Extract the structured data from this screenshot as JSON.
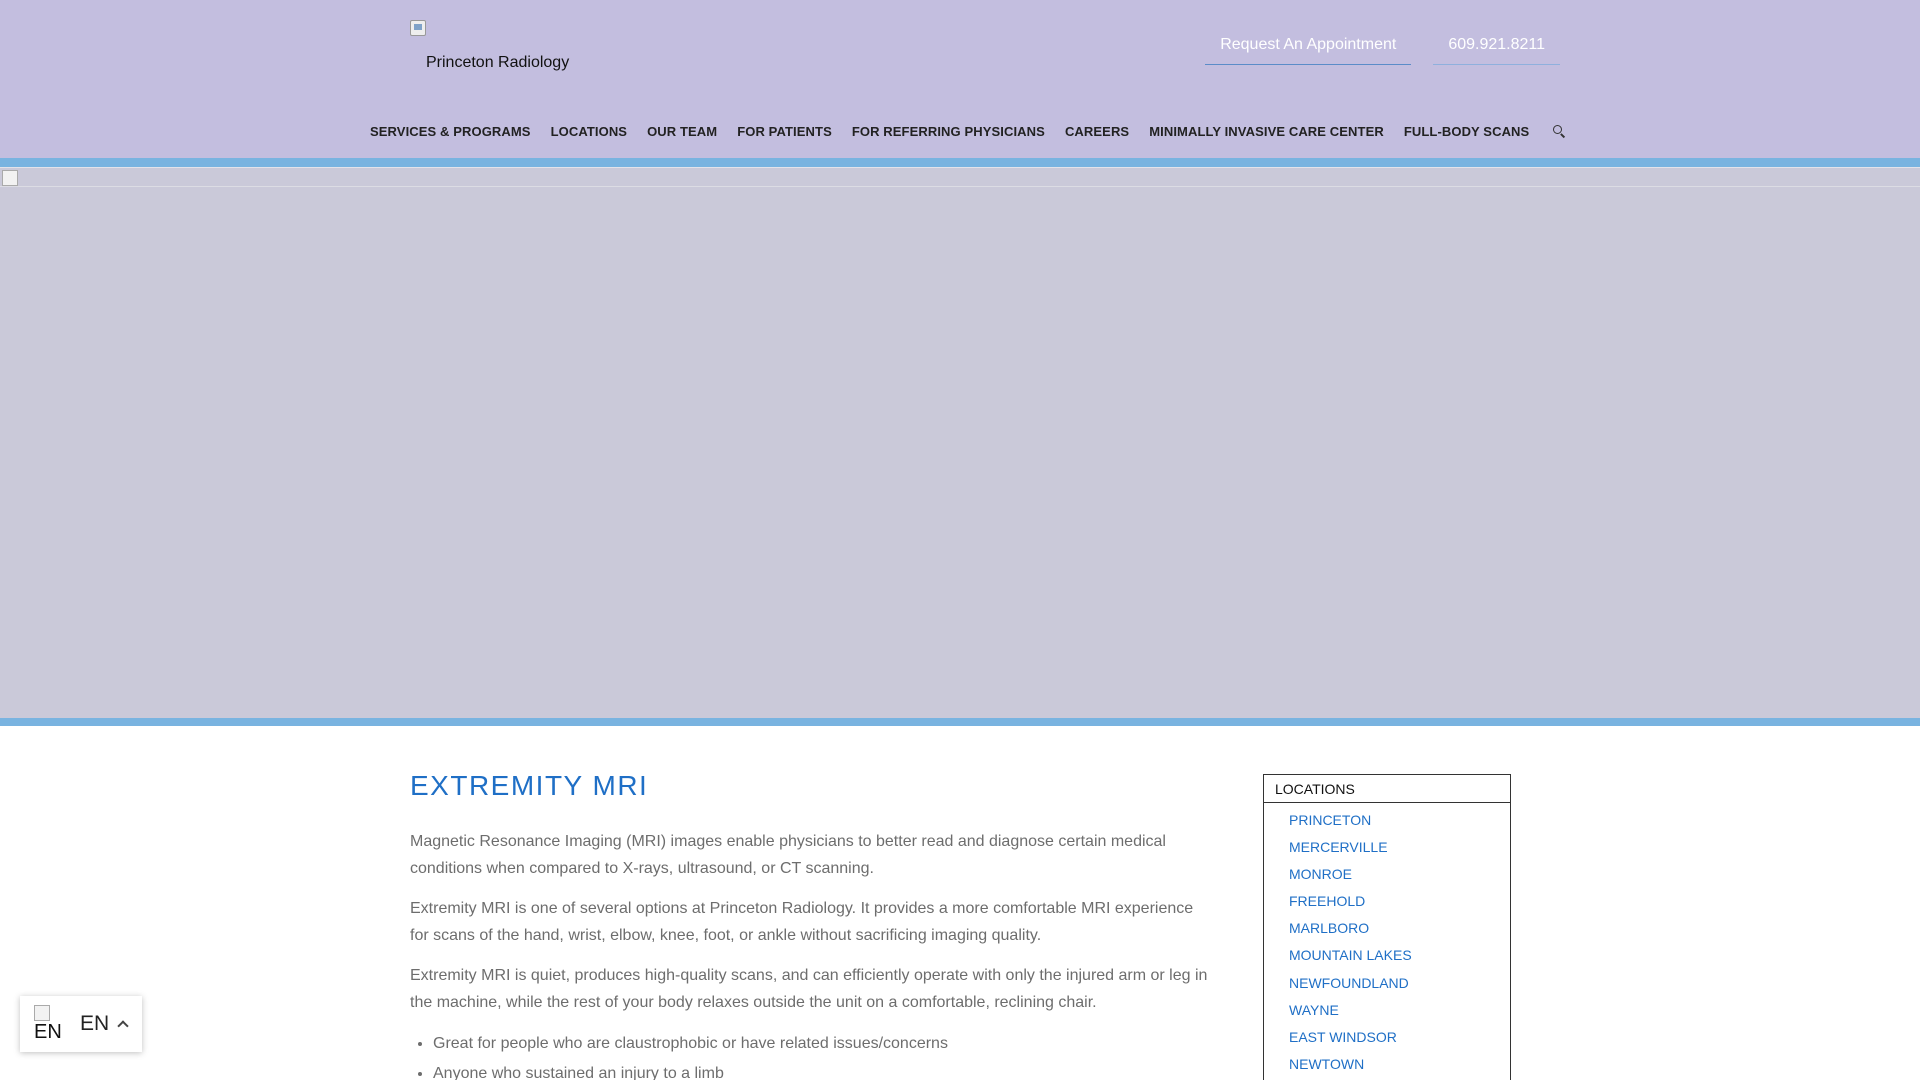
{
  "header": {
    "logo_alt": "Princeton Radiology",
    "appointment_label": "Request An Appointment",
    "phone_label": " 609.921.8211"
  },
  "nav": {
    "items": [
      {
        "label": "SERVICES & PROGRAMS"
      },
      {
        "label": "LOCATIONS"
      },
      {
        "label": "OUR TEAM"
      },
      {
        "label": "FOR PATIENTS"
      },
      {
        "label": "FOR REFERRING PHYSICIANS"
      },
      {
        "label": "CAREERS"
      },
      {
        "label": "MINIMALLY INVASIVE CARE CENTER"
      },
      {
        "label": "FULL-BODY SCANS"
      }
    ],
    "search_icon": "search-icon"
  },
  "main": {
    "title": "EXTREMITY MRI",
    "paragraphs": [
      "Magnetic Resonance Imaging (MRI) images enable physicians to better read and diagnose certain medical conditions when compared to X-rays, ultrasound, or CT scanning.",
      "Extremity MRI is one of several options at Princeton Radiology. It provides a more comfortable MRI experience for scans of the hand, wrist, elbow, knee, foot, or ankle without sacrificing imaging quality.",
      "Extremity MRI is quiet, produces high-quality scans, and can efficiently operate with only the injured arm or leg in the machine, while the rest of your body relaxes outside the unit on a comfortable, reclining chair."
    ],
    "bullets": [
      "Great for people who are claustrophobic or have related issues/concerns",
      "Anyone who sustained an injury to a limb"
    ]
  },
  "sidebar": {
    "title": "LOCATIONS",
    "items": [
      "PRINCETON",
      "MERCERVILLE",
      "MONROE",
      "FREEHOLD",
      "MARLBORO",
      "MOUNTAIN LAKES",
      "NEWFOUNDLAND",
      "WAYNE",
      "EAST WINDSOR",
      "NEWTOWN"
    ]
  },
  "language": {
    "flag_alt": "EN",
    "code": "EN"
  },
  "colors": {
    "header_bg": "#c3bedf",
    "accent_bar": "#79b3e0",
    "link_blue": "#1f6fc6",
    "hero_bg": "#cac9d9"
  }
}
